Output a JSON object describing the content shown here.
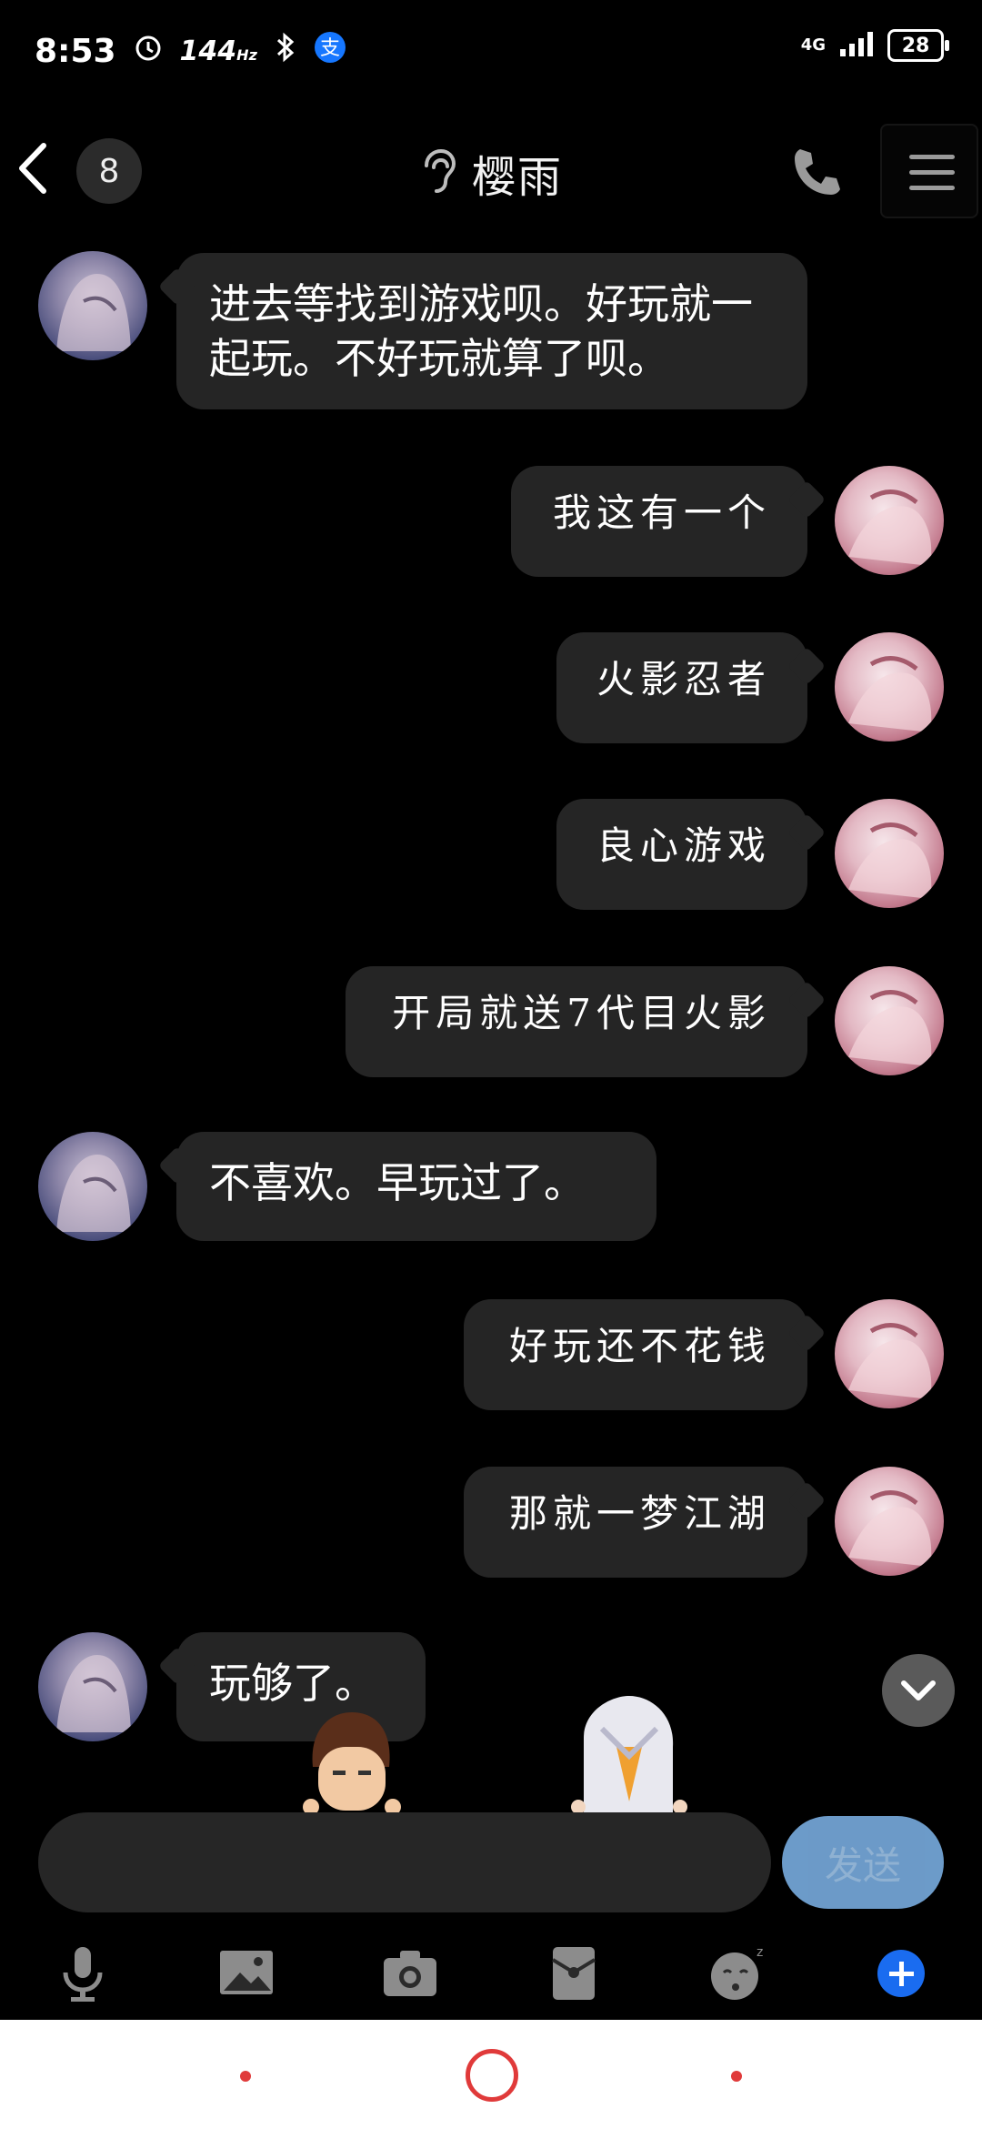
{
  "status_bar": {
    "time": "8:53",
    "refresh_rate": "144",
    "refresh_unit": "Hz",
    "network": "4G",
    "battery": "28"
  },
  "header": {
    "unread_count": "8",
    "contact_name": "樱雨"
  },
  "messages": [
    {
      "side": "in",
      "text": "进去等找到游戏呗。好玩就一起玩。不好玩就算了呗。"
    },
    {
      "side": "out",
      "text": "我这有一个"
    },
    {
      "side": "out",
      "text": "火影忍者"
    },
    {
      "side": "out",
      "text": "良心游戏"
    },
    {
      "side": "out",
      "text": "开局就送7代目火影"
    },
    {
      "side": "in",
      "text": "不喜欢。早玩过了。"
    },
    {
      "side": "out",
      "text": "好玩还不花钱"
    },
    {
      "side": "out",
      "text": "那就一梦江湖"
    },
    {
      "side": "in",
      "text": "玩够了。"
    }
  ],
  "input": {
    "value": "",
    "send_label": "发送"
  },
  "toolbar_icons": [
    "microphone-icon",
    "image-icon",
    "camera-icon",
    "red-packet-icon",
    "emoji-icon",
    "plus-icon"
  ],
  "colors": {
    "bubble": "#252525",
    "send_button": "#7fb6ec",
    "plus": "#1a6cf0",
    "nav_accent": "#e03a3a"
  }
}
